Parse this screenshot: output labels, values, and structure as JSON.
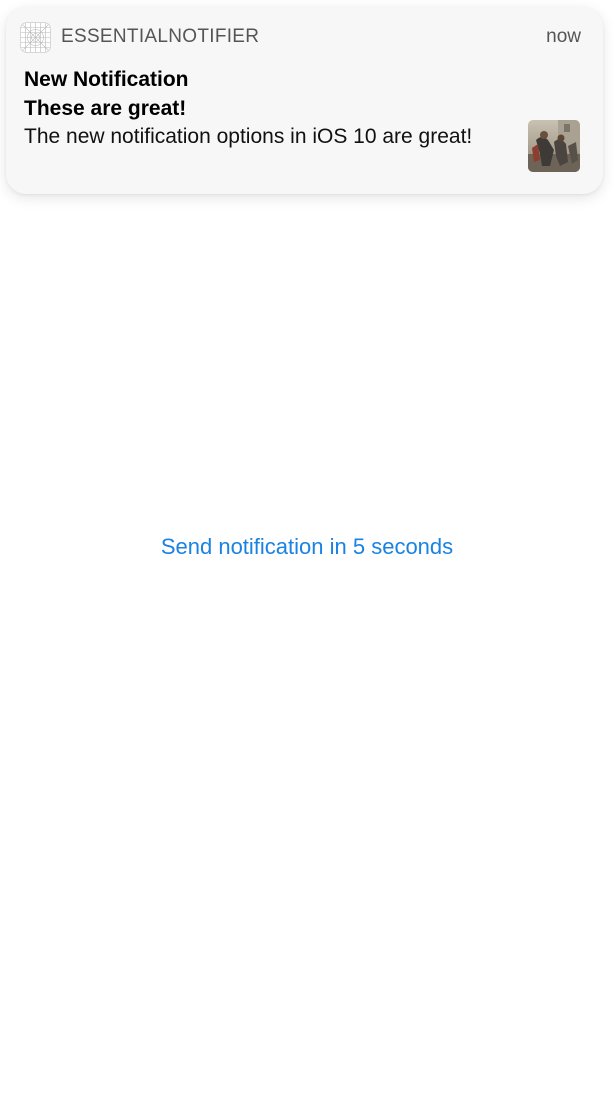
{
  "notification": {
    "app_name": "ESSENTIALNOTIFIER",
    "time": "now",
    "title": "New Notification",
    "subtitle": "These are great!",
    "message": "The new notification options in iOS 10 are great!",
    "app_icon": "placeholder-grid-icon",
    "attachment_icon": "photo-thumbnail"
  },
  "main": {
    "send_button_label": "Send notification in 5 seconds"
  },
  "colors": {
    "accent": "#1a82e2",
    "card_background": "#f7f7f7",
    "secondary_text": "#555555"
  }
}
